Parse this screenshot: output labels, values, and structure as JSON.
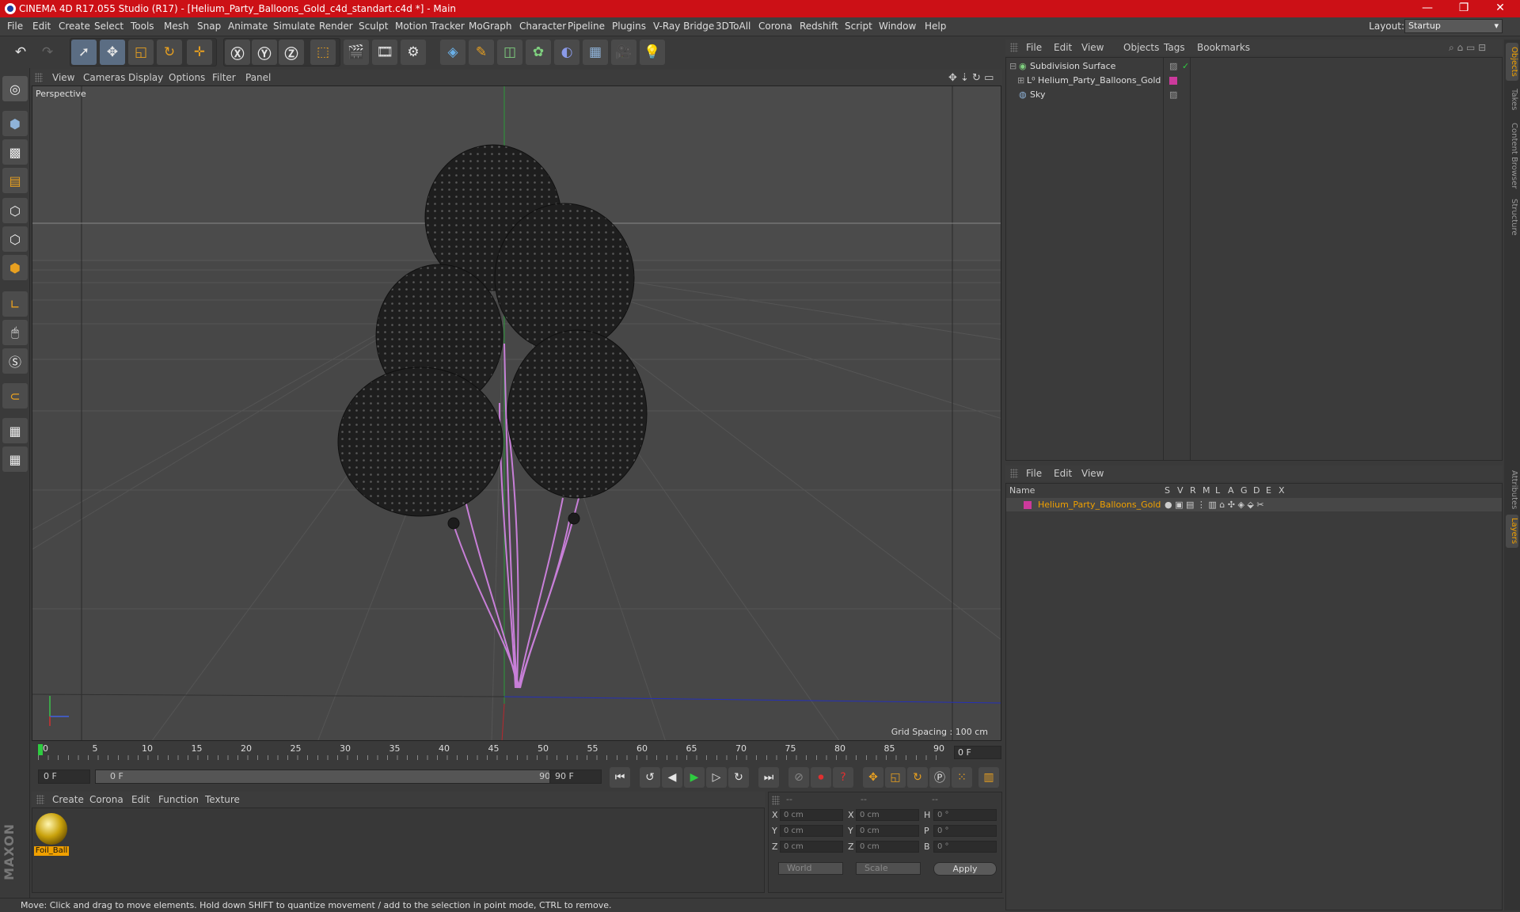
{
  "window": {
    "title": "CINEMA 4D R17.055 Studio (R17) - [Helium_Party_Balloons_Gold_c4d_standart.c4d *] - Main",
    "minimize": "—",
    "maximize": "❐",
    "close": "✕"
  },
  "menu": [
    "File",
    "Edit",
    "Create",
    "Select",
    "Tools",
    "Mesh",
    "Snap",
    "Animate",
    "Simulate",
    "Render",
    "Sculpt",
    "Motion Tracker",
    "MoGraph",
    "Character",
    "Pipeline",
    "Plugins",
    "V-Ray Bridge",
    "3DToAll",
    "Corona",
    "Redshift",
    "Script",
    "Window",
    "Help"
  ],
  "layout": {
    "label": "Layout:",
    "value": "Startup"
  },
  "viewport": {
    "menu": [
      "View",
      "Cameras",
      "Display",
      "Options",
      "Filter",
      "Panel"
    ],
    "label": "Perspective",
    "grid_spacing": "Grid Spacing : 100 cm"
  },
  "timeline": {
    "ticks": [
      "0",
      "5",
      "10",
      "15",
      "20",
      "25",
      "30",
      "35",
      "40",
      "45",
      "50",
      "55",
      "60",
      "65",
      "70",
      "75",
      "80",
      "85",
      "90"
    ],
    "current_frame": "0 F",
    "start_field": "0 F",
    "range_start": "0 F",
    "range_end": "90 F",
    "end_field": "90 F"
  },
  "material_manager": {
    "menu": [
      "Create",
      "Corona",
      "Edit",
      "Function",
      "Texture"
    ],
    "materials": [
      {
        "name": "Foil_Ball"
      }
    ]
  },
  "coordinates": {
    "headers": [
      "--",
      "--",
      "--"
    ],
    "rows": [
      {
        "axis": "X",
        "pos": "0 cm",
        "axis2": "X",
        "size": "0 cm",
        "rot_label": "H",
        "rot": "0 °"
      },
      {
        "axis": "Y",
        "pos": "0 cm",
        "axis2": "Y",
        "size": "0 cm",
        "rot_label": "P",
        "rot": "0 °"
      },
      {
        "axis": "Z",
        "pos": "0 cm",
        "axis2": "Z",
        "size": "0 cm",
        "rot_label": "B",
        "rot": "0 °"
      }
    ],
    "mode1": "World",
    "mode2": "Scale",
    "apply": "Apply"
  },
  "status": "Move: Click and drag to move elements. Hold down SHIFT to quantize movement / add to the selection in point mode, CTRL to remove.",
  "object_manager": {
    "menu": [
      "File",
      "Edit",
      "View",
      "Objects",
      "Tags",
      "Bookmarks"
    ],
    "objects": [
      {
        "name": "Subdivision Surface",
        "icon": "subdivision-icon",
        "color": "#7fd07f"
      },
      {
        "name": "Helium_Party_Balloons_Gold",
        "icon": "null-icon",
        "color": "#cc3a9c"
      },
      {
        "name": "Sky",
        "icon": "sky-icon",
        "color": "#8fb3d9"
      }
    ]
  },
  "layer_manager": {
    "menu": [
      "File",
      "Edit",
      "View"
    ],
    "columns": [
      "Name",
      "S",
      "V",
      "R",
      "M",
      "L",
      "A",
      "G",
      "D",
      "E",
      "X"
    ],
    "layers": [
      {
        "name": "Helium_Party_Balloons_Gold",
        "color": "#cc3a9c"
      }
    ]
  },
  "right_tabs": [
    "Objects",
    "Takes",
    "Content Browser",
    "Structure",
    "Attributes",
    "Layers"
  ],
  "colors": {
    "title_bar": "#cc1016",
    "accent": "#f0a000",
    "balloon": "#1c1c1c",
    "string": "#c87fd8"
  }
}
